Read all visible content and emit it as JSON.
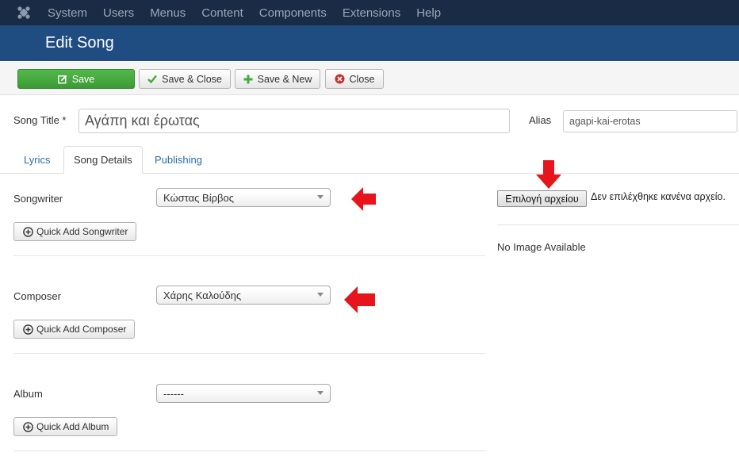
{
  "topnav": {
    "items": [
      "System",
      "Users",
      "Menus",
      "Content",
      "Components",
      "Extensions",
      "Help"
    ]
  },
  "page": {
    "title": "Edit Song"
  },
  "toolbar": {
    "save": "Save",
    "save_close": "Save & Close",
    "save_new": "Save & New",
    "close": "Close"
  },
  "form": {
    "song_title_label": "Song Title *",
    "song_title_value": "Αγάπη και έρωτας",
    "alias_label": "Alias",
    "alias_value": "agapi-kai-erotas"
  },
  "tabs": [
    "Lyrics",
    "Song Details",
    "Publishing"
  ],
  "details": {
    "songwriter_label": "Songwriter",
    "songwriter_value": "Κώστας Βίρβος",
    "quick_add_songwriter": "Quick Add Songwriter",
    "composer_label": "Composer",
    "composer_value": "Χάρης Καλούδης",
    "quick_add_composer": "Quick Add Composer",
    "album_label": "Album",
    "album_value": "------",
    "quick_add_album": "Quick Add Album"
  },
  "file": {
    "choose_button": "Επιλογή αρχείου",
    "no_file_text": "Δεν επιλέχθηκε κανένα αρχείο.",
    "no_image": "No Image Available"
  },
  "colors": {
    "nav_bg": "#1a2b45",
    "title_bg": "#1f4d82",
    "save_green": "#46a941",
    "annotation_red": "#e8141b",
    "link_blue": "#2a6ea8"
  }
}
